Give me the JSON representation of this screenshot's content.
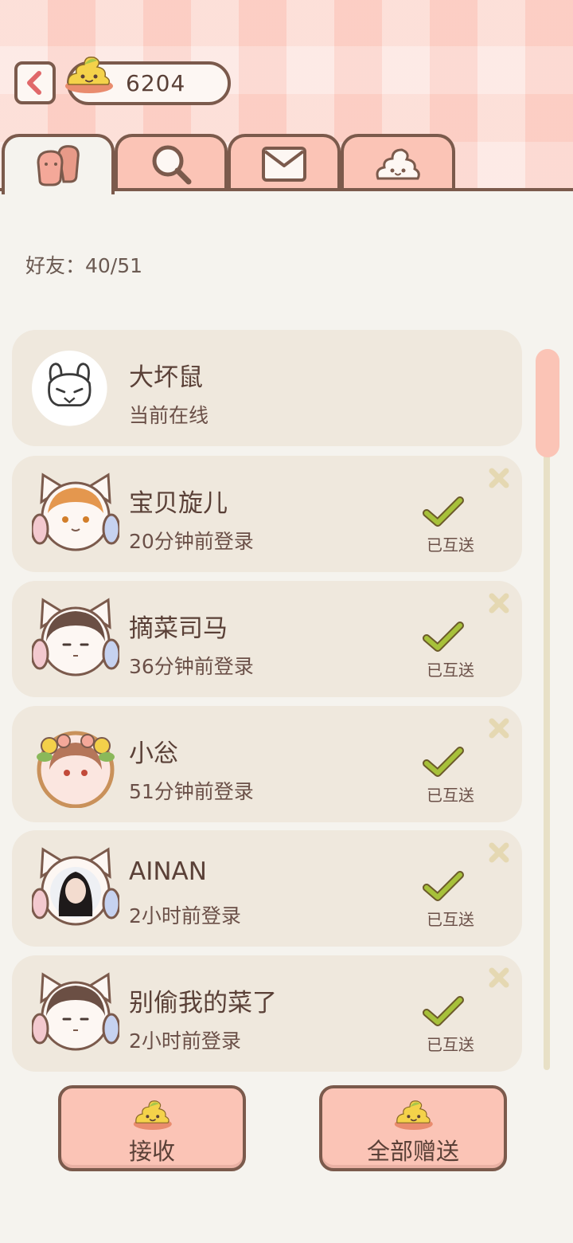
{
  "header": {
    "coins": "6204"
  },
  "tabs": [
    {
      "id": "friends",
      "icon": "friends-icon",
      "active": true
    },
    {
      "id": "search",
      "icon": "search-icon",
      "active": false
    },
    {
      "id": "mail",
      "icon": "mail-icon",
      "active": false
    },
    {
      "id": "gift",
      "icon": "poop-icon",
      "active": false
    }
  ],
  "friends_count": "好友：40/51",
  "friends": [
    {
      "name": "大坏鼠",
      "status": "当前在线",
      "mutual": ""
    },
    {
      "name": "宝贝旋儿",
      "status": "20分钟前登录",
      "mutual": "已互送"
    },
    {
      "name": "摘菜司马",
      "status": "36分钟前登录",
      "mutual": "已互送"
    },
    {
      "name": "小忩",
      "status": "51分钟前登录",
      "mutual": "已互送"
    },
    {
      "name": "AINAN",
      "status": "2小时前登录",
      "mutual": "已互送"
    },
    {
      "name": "别偷我的菜了",
      "status": "2小时前登录",
      "mutual": "已互送"
    }
  ],
  "buttons": {
    "receive": "接收",
    "send_all": "全部赠送"
  },
  "colors": {
    "accent_pink": "#fbc4b6",
    "border_brown": "#7b5a4c",
    "check_green": "#a7c13a"
  }
}
